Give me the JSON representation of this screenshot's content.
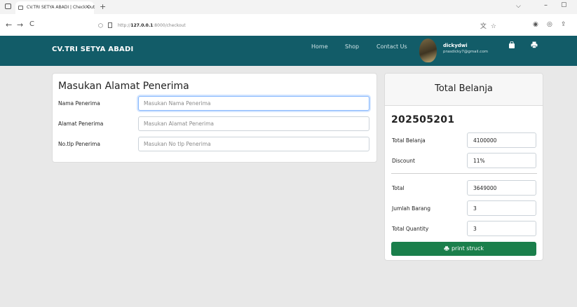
{
  "browser": {
    "tab_title": "CV.TRI SETYA ABADI | Check Out",
    "tab_close": "×",
    "new_tab": "+",
    "url_scheme": "http://",
    "url_host": "127.0.0.1",
    "url_path": ":8000/checkout",
    "nav_back": "←",
    "nav_forward": "→",
    "nav_reload": "C",
    "win_min": "–",
    "win_restore": "▢",
    "dropdown": "⌵"
  },
  "navbar": {
    "brand": "CV.TRI SETYA ABADI",
    "links": [
      "Home",
      "Shop",
      "Contact Us"
    ],
    "user_name": "dickydwi",
    "user_email": "prasdicky7@gmail.com",
    "accent": "#125c68"
  },
  "form": {
    "title": "Masukan Alamat Penerima",
    "fields": [
      {
        "label": "Nama Penerima",
        "placeholder": "Masukan Nama Penerima",
        "value": ""
      },
      {
        "label": "Alamat Penerima",
        "placeholder": "Masukan Alamat Penerima",
        "value": ""
      },
      {
        "label": "No.tlp Penerima",
        "placeholder": "Masukan No tlp Penerima",
        "value": ""
      }
    ]
  },
  "summary": {
    "title": "Total Belanja",
    "order_id": "202505201",
    "rows": [
      {
        "label": "Total Belanja",
        "value": "4100000"
      },
      {
        "label": "Discount",
        "value": "11%"
      },
      {
        "label": "Total",
        "value": "3649000"
      },
      {
        "label": "Jumlah Barang",
        "value": "3"
      },
      {
        "label": "Total Quantity",
        "value": "3"
      }
    ],
    "print_button": "print struck",
    "button_color": "#1a7f4b"
  }
}
